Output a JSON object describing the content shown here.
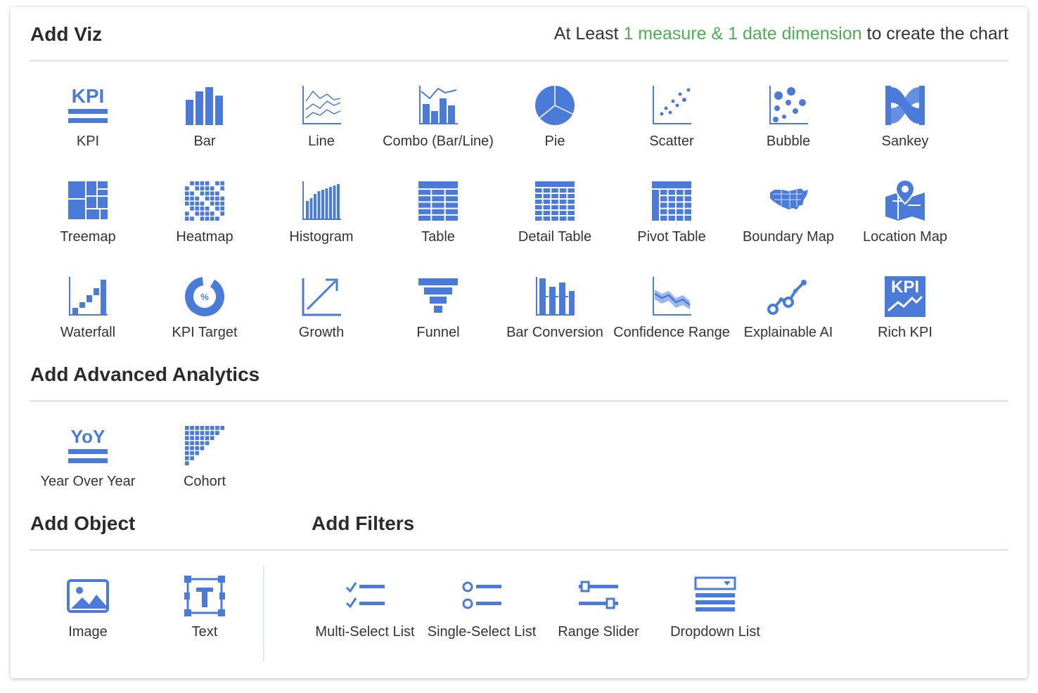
{
  "colors": {
    "accent": "#4a7bd9",
    "hint_green": "#4caf50",
    "text": "#333333",
    "divider": "#e4e9ef"
  },
  "viz": {
    "title": "Add Viz",
    "hint": {
      "prefix": "At Least ",
      "highlight": "1 measure & 1 date dimension",
      "suffix": " to create the chart"
    },
    "items": [
      {
        "label": "KPI",
        "icon": "kpi-icon"
      },
      {
        "label": "Bar",
        "icon": "bar-chart-icon"
      },
      {
        "label": "Line",
        "icon": "line-chart-icon"
      },
      {
        "label": "Combo (Bar/Line)",
        "icon": "combo-chart-icon"
      },
      {
        "label": "Pie",
        "icon": "pie-chart-icon"
      },
      {
        "label": "Scatter",
        "icon": "scatter-chart-icon"
      },
      {
        "label": "Bubble",
        "icon": "bubble-chart-icon"
      },
      {
        "label": "Sankey",
        "icon": "sankey-icon"
      },
      {
        "label": "Treemap",
        "icon": "treemap-icon"
      },
      {
        "label": "Heatmap",
        "icon": "heatmap-icon"
      },
      {
        "label": "Histogram",
        "icon": "histogram-icon"
      },
      {
        "label": "Table",
        "icon": "table-icon"
      },
      {
        "label": "Detail Table",
        "icon": "detail-table-icon"
      },
      {
        "label": "Pivot Table",
        "icon": "pivot-table-icon"
      },
      {
        "label": "Boundary Map",
        "icon": "boundary-map-icon"
      },
      {
        "label": "Location Map",
        "icon": "location-map-icon"
      },
      {
        "label": "Waterfall",
        "icon": "waterfall-icon"
      },
      {
        "label": "KPI Target",
        "icon": "kpi-target-icon"
      },
      {
        "label": "Growth",
        "icon": "growth-icon"
      },
      {
        "label": "Funnel",
        "icon": "funnel-icon"
      },
      {
        "label": "Bar Conversion",
        "icon": "bar-conversion-icon"
      },
      {
        "label": "Confidence Range",
        "icon": "confidence-range-icon"
      },
      {
        "label": "Explainable AI",
        "icon": "explainable-ai-icon"
      },
      {
        "label": "Rich KPI",
        "icon": "rich-kpi-icon"
      }
    ]
  },
  "analytics": {
    "title": "Add Advanced Analytics",
    "items": [
      {
        "label": "Year Over Year",
        "icon": "yoy-icon"
      },
      {
        "label": "Cohort",
        "icon": "cohort-icon"
      }
    ]
  },
  "object": {
    "title": "Add Object",
    "items": [
      {
        "label": "Image",
        "icon": "image-icon"
      },
      {
        "label": "Text",
        "icon": "text-box-icon"
      }
    ]
  },
  "filters": {
    "title": "Add Filters",
    "items": [
      {
        "label": "Multi-Select List",
        "icon": "multi-select-list-icon"
      },
      {
        "label": "Single-Select List",
        "icon": "single-select-list-icon"
      },
      {
        "label": "Range Slider",
        "icon": "range-slider-icon"
      },
      {
        "label": "Dropdown List",
        "icon": "dropdown-list-icon"
      }
    ]
  }
}
